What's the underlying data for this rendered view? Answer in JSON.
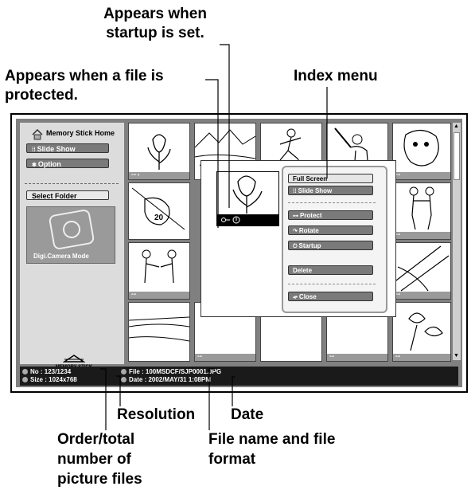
{
  "callouts": {
    "startup": [
      "Appears when",
      "startup is set."
    ],
    "protected": [
      "Appears when a file is",
      "protected."
    ],
    "index_menu": "Index menu",
    "resolution": "Resolution",
    "date": "Date",
    "order": [
      "Order/total",
      "number of",
      "picture files"
    ],
    "filename": [
      "File name and file",
      "format"
    ]
  },
  "screen": {
    "home_label": "Memory Stick Home",
    "left_buttons": [
      "Slide Show",
      "Option"
    ],
    "select_folder": "Select Folder",
    "camera_mode": "Digi.Camera Mode",
    "logo_text": "MEMORY STICK"
  },
  "menu": {
    "items": [
      "Full Screen",
      "Slide Show",
      "Protect",
      "Rotate",
      "Startup",
      "Delete",
      "Close"
    ]
  },
  "status": {
    "no": "No   : 123/1234",
    "size": "Size : 1024x768",
    "file": "File  : 100MSDCF/SJP0001.JPG",
    "date": "Date : 2002/MAY/31 1:08PM"
  },
  "colors": {
    "panel": "#dcdcdc",
    "screen_bg": "#808080",
    "button": "#7a7a7a",
    "status_bar": "#1a1a1a"
  }
}
